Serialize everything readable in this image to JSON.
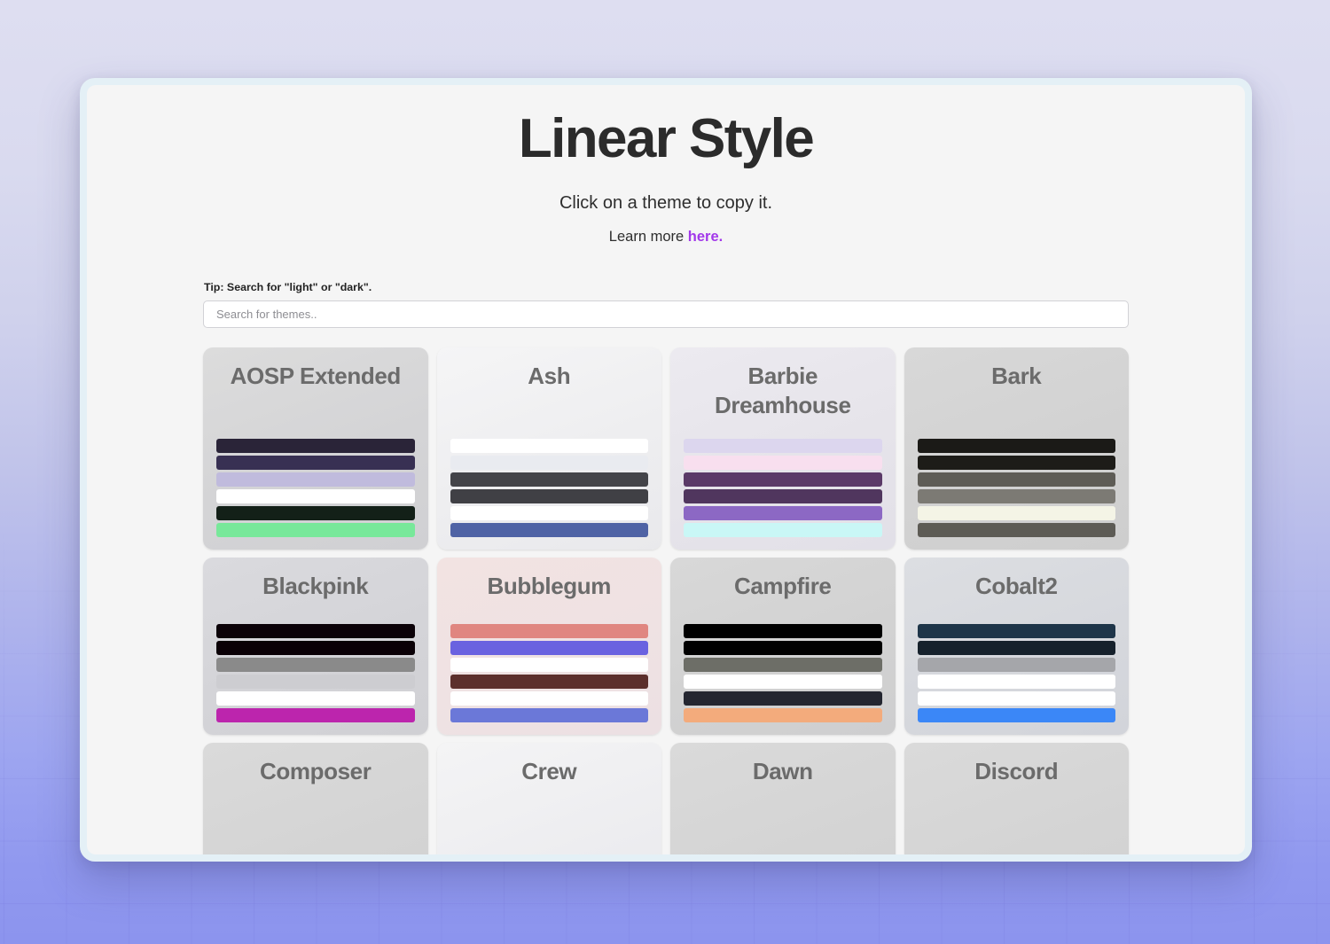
{
  "page": {
    "title": "Linear Style",
    "subtitle": "Click on a theme to copy it.",
    "learn_more_prefix": "Learn more ",
    "learn_more_link": "here."
  },
  "search": {
    "tip": "Tip: Search for \"light\" or \"dark\".",
    "placeholder": "Search for themes..",
    "value": ""
  },
  "colors": {
    "accent_link": "#a238ea",
    "page_background": "#f5f5f5",
    "window_border": "#e4f0f6",
    "desktop_gradient_top": "#dedef1",
    "desktop_gradient_bottom": "#8c94ee"
  },
  "themes": [
    {
      "name": "AOSP Extended",
      "card_bg": "linear-gradient(160deg,#dcdcdc 0%,#d4d4d6 55%,#d0d0d3 100%)",
      "swatches": [
        "#2a2438",
        "#383053",
        "#c0bbdd",
        "#ffffff",
        "#132018",
        "#78e89a"
      ]
    },
    {
      "name": "Ash",
      "card_bg": "linear-gradient(160deg,#f5f5f6 0%,#eeeef0 55%,#e9e9ec 100%)",
      "swatches": [
        "#ffffff",
        "#e9ebf0",
        "#444449",
        "#404045",
        "#ffffff",
        "#4f63a5"
      ]
    },
    {
      "name": "Barbie Dreamhouse",
      "card_bg": "linear-gradient(160deg,#eceaf0 0%,#e6e4ea 55%,#e2e0e8 100%)",
      "swatches": [
        "#dcd6ee",
        "#f8dfef",
        "#5b3a68",
        "#50365e",
        "#8c68c4",
        "#c9f7f6"
      ]
    },
    {
      "name": "Bark",
      "card_bg": "linear-gradient(160deg,#d8d8d8 0%,#d2d2d2 55%,#cecece 100%)",
      "swatches": [
        "#1b1a17",
        "#1d1c18",
        "#5e5c56",
        "#7c7a74",
        "#f4f4e6",
        "#5d5b55"
      ]
    },
    {
      "name": "Blackpink",
      "card_bg": "linear-gradient(160deg,#dadade 0%,#d4d4d8 55%,#d0d0d4 100%)",
      "swatches": [
        "#0b0208",
        "#0a0006",
        "#8a8a8a",
        "#cdcdd1",
        "#ffffff",
        "#bc25ad"
      ]
    },
    {
      "name": "Bubblegum",
      "card_bg": "linear-gradient(160deg,#f2e3e2 0%,#efe2e3 55%,#ece0e3 100%)",
      "swatches": [
        "#e08680",
        "#6a62e0",
        "#ffffff",
        "#5c2f2c",
        "#ffffff",
        "#6b78d8"
      ]
    },
    {
      "name": "Campfire",
      "card_bg": "linear-gradient(160deg,#d8d8d8 0%,#d2d2d2 55%,#cececf 100%)",
      "swatches": [
        "#000000",
        "#010101",
        "#6d6e67",
        "#ffffff",
        "#242630",
        "#f3ab7c"
      ]
    },
    {
      "name": "Cobalt2",
      "card_bg": "linear-gradient(160deg,#dcdee2 0%,#d6d8dd 55%,#d2d4da 100%)",
      "swatches": [
        "#1e3549",
        "#16212c",
        "#a5a6aa",
        "#ffffff",
        "#ffffff",
        "#3b87f7"
      ]
    },
    {
      "name": "Composer",
      "card_bg": "linear-gradient(160deg,#dadada 0%,#d4d4d4 55%,#d0d0d0 100%)",
      "swatches": [
        "#0c0c0c",
        "#20392b",
        "#eaeaec",
        "#f3f3f4"
      ]
    },
    {
      "name": "Crew",
      "card_bg": "linear-gradient(160deg,#f4f4f5 0%,#ededf0 55%,#e8e8eb 100%)",
      "swatches": [
        "#f7f7fa",
        "#1d1d33",
        "#8c8c9b",
        "#2d2f35"
      ]
    },
    {
      "name": "Dawn",
      "card_bg": "linear-gradient(160deg,#dadada 0%,#d4d4d4 55%,#d0d0d0 100%)",
      "swatches": [
        "#2d2330",
        "#3d2c40",
        "#edeef1",
        "#f0f0f2"
      ]
    },
    {
      "name": "Discord",
      "card_bg": "linear-gradient(160deg,#dadada 0%,#d4d4d4 55%,#d0d0d0 100%)",
      "swatches": [
        "#37393e",
        "#2e2f34",
        "#e8e8ea",
        "#eeeeee"
      ]
    }
  ]
}
